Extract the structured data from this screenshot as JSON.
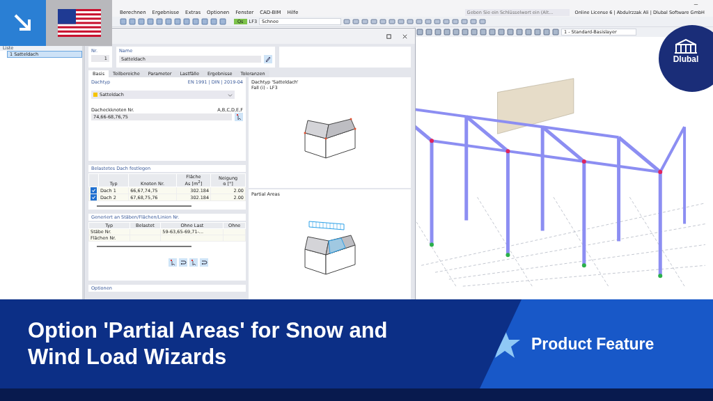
{
  "menu": [
    "Berechnen",
    "Ergebnisse",
    "Extras",
    "Optionen",
    "Fenster",
    "CAD-BIM",
    "Hilfe"
  ],
  "search": {
    "placeholder": "Geben Sie ein Schlüsselwort ein (Alt..."
  },
  "license": "Online License 6 | Abdulrzzak Ali | Dlubal Software GmbH",
  "toolbar": {
    "load_type": "Qs",
    "load_case": "LF3",
    "load_name": "Schnee",
    "layer": "1 - Standard-Basislayer"
  },
  "navigator": {
    "title": "Liste",
    "items": [
      {
        "number": "1",
        "label": "Satteldach",
        "selected": true
      }
    ]
  },
  "dialog": {
    "nr_label": "Nr.",
    "nr": "1",
    "name_label": "Name",
    "name": "Satteldach",
    "tabs": [
      {
        "label": "Basis",
        "selected": true
      },
      {
        "label": "Teilbereiche",
        "selected": false
      },
      {
        "label": "Parameter",
        "selected": false
      },
      {
        "label": "Lastfälle",
        "selected": false
      },
      {
        "label": "Ergebnisse",
        "selected": false
      },
      {
        "label": "Toleranzen",
        "selected": false
      }
    ],
    "roof_type": {
      "title": "Dachtyp",
      "norm": "EN 1991 | DIN | 2019-04",
      "value": "Satteldach"
    },
    "corner_nodes": {
      "label": "Dacheckknoten Nr.",
      "hint": "A,B,C,D,E,F",
      "value": "74,66-68,76,75"
    },
    "loaded_roof": {
      "title": "Belastetes Dach festlegen",
      "columns": [
        {
          "lines": [
            "Typ"
          ]
        },
        {
          "lines": [
            "Knoten Nr."
          ]
        },
        {
          "lines": [
            "Fläche",
            "As [m$^{2}$]"
          ]
        },
        {
          "lines": [
            "Neigung",
            "α [°]"
          ]
        }
      ],
      "rows": [
        {
          "checked": true,
          "type": "Dach 1",
          "nodes": "66,67,74,75",
          "area": "302.184",
          "slope": "2.00"
        },
        {
          "checked": true,
          "type": "Dach 2",
          "nodes": "67,68,75,76",
          "area": "302.184",
          "slope": "2.00"
        }
      ]
    },
    "generated": {
      "title": "Generiert an Stäben/Flächen/Linien Nr.",
      "columns": [
        "Typ",
        "Belastet",
        "Ohne Last",
        "Ohne"
      ],
      "rows": [
        {
          "type": "Stäbe Nr.",
          "without_load": "59-63,65-69,71-..."
        },
        {
          "type": "Flächen Nr."
        }
      ]
    },
    "options_title": "Optionen",
    "previews": [
      {
        "kind": "roof",
        "title": "Dachtyp 'Satteldach'",
        "subtitle": "Fall (i) - LF3"
      },
      {
        "kind": "partial",
        "title": "Partial Areas"
      }
    ]
  },
  "logo": "Dlubal",
  "banner": {
    "title": "Option 'Partial Areas' for Snow and Wind Load Wizards",
    "badge": "Product Feature"
  }
}
